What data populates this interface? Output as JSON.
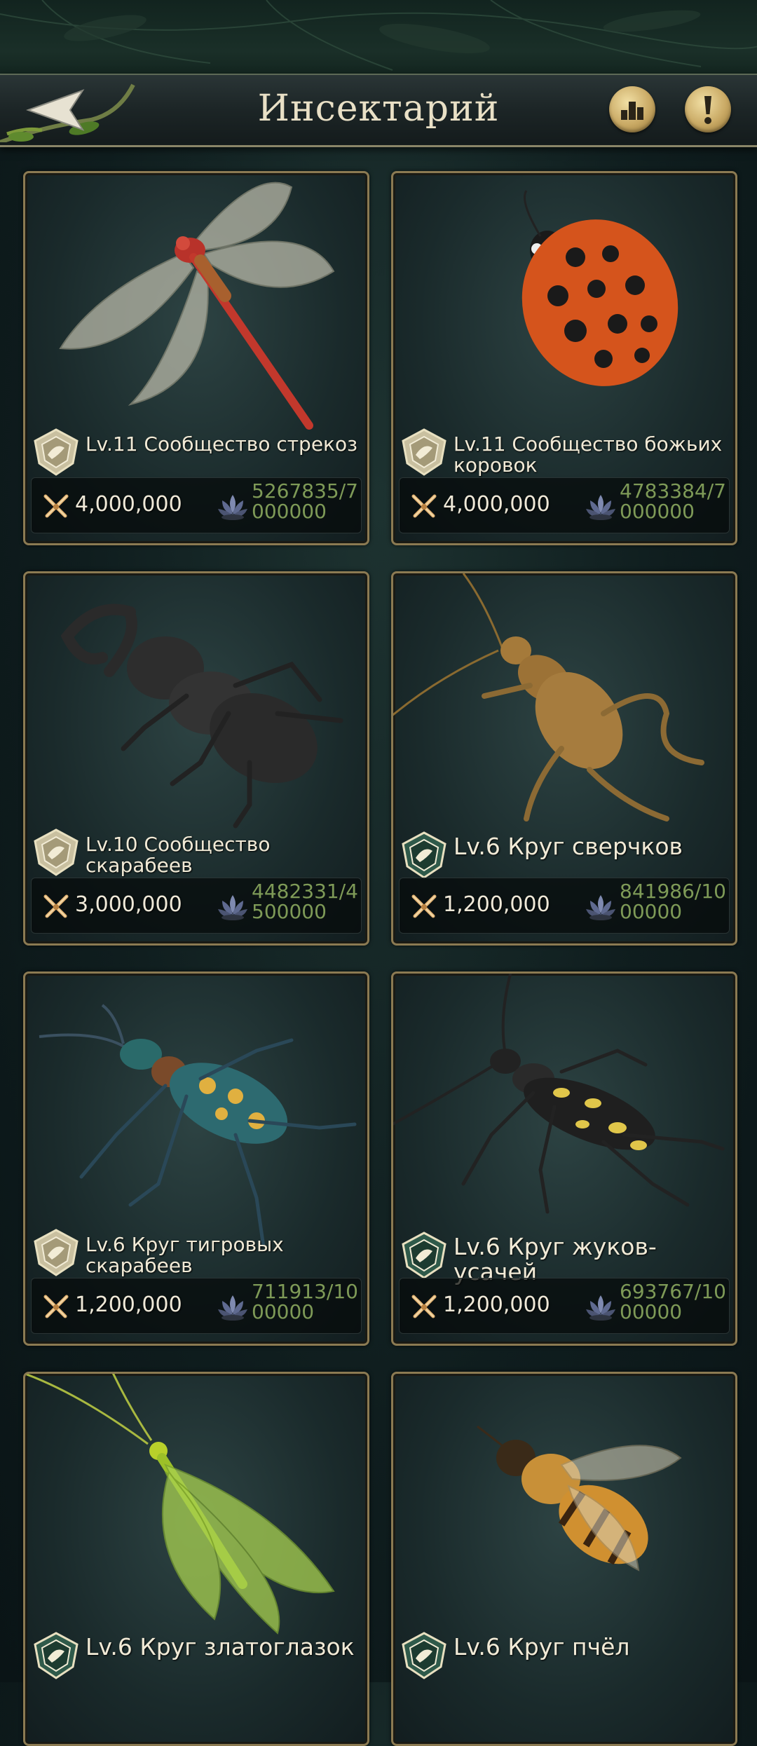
{
  "header": {
    "title": "Инсектарий"
  },
  "icons": {
    "back": "back-arrow-icon",
    "rank": "leaderboard-icon",
    "info": "exclamation-icon",
    "power": "crossed-swords-icon",
    "resource": "lotus-icon"
  },
  "colors": {
    "card_border": "#8b7a52",
    "resource_text": "#7e9a57",
    "title_text": "#e9e0c6"
  },
  "cards": [
    {
      "name": "Lv.11 Сообщество стрекоз",
      "power": "4,000,000",
      "resource": "5267835/7000000",
      "insect": "dragonfly"
    },
    {
      "name": "Lv.11 Сообщество божьих коровок",
      "power": "4,000,000",
      "resource": "4783384/7000000",
      "insect": "ladybug"
    },
    {
      "name": "Lv.10 Сообщество скарабеев",
      "power": "3,000,000",
      "resource": "4482331/4500000",
      "insect": "stag-beetle"
    },
    {
      "name": "Lv.6 Круг сверчков",
      "power": "1,200,000",
      "resource": "841986/1000000",
      "insect": "cricket"
    },
    {
      "name": "Lv.6 Круг тигровых скарабеев",
      "power": "1,200,000",
      "resource": "711913/1000000",
      "insect": "tiger-beetle"
    },
    {
      "name": "Lv.6 Круг жуков-усачей",
      "power": "1,200,000",
      "resource": "693767/1000000",
      "insect": "longhorn-beetle"
    },
    {
      "name": "Lv.6 Круг златоглазок",
      "insect": "lacewing"
    },
    {
      "name": "Lv.6 Круг пчёл",
      "insect": "bee"
    }
  ]
}
